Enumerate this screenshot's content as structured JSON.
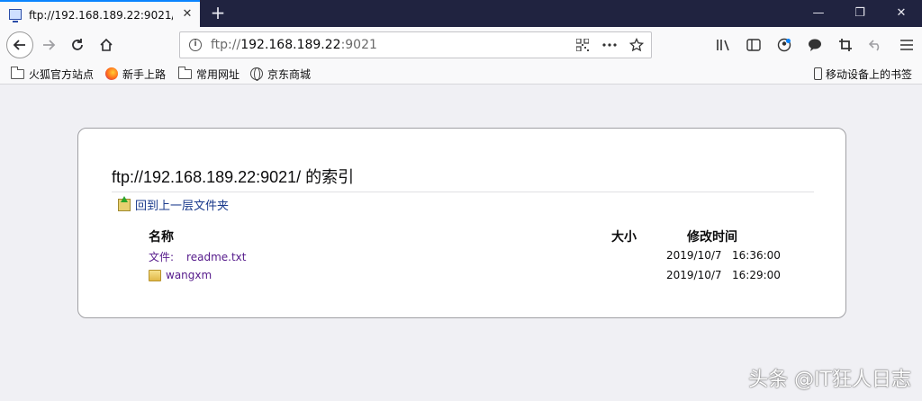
{
  "tab": {
    "title": "ftp://192.168.189.22:9021/ 的"
  },
  "window": {
    "minimize": "—",
    "restore": "❐",
    "close": "✕",
    "new_tab": "+"
  },
  "url": {
    "scheme": "ftp://",
    "host": "192.168.189.22",
    "port": ":9021"
  },
  "bookmarks": [
    {
      "label": "火狐官方站点",
      "icon": "folder-icon"
    },
    {
      "label": "新手上路",
      "icon": "firefox-icon"
    },
    {
      "label": "常用网址",
      "icon": "folder-icon"
    },
    {
      "label": "京东商城",
      "icon": "globe-icon"
    }
  ],
  "mobile_bookmarks": "移动设备上的书签",
  "page": {
    "heading": "ftp://192.168.189.22:9021/ 的索引",
    "up_link": "回到上一层文件夹",
    "columns": {
      "name": "名称",
      "size": "大小",
      "modified": "修改时间"
    },
    "rows": [
      {
        "prefix": "文件:",
        "name": "readme.txt",
        "date": "2019/10/7",
        "time": "16:36:00",
        "kind": "file"
      },
      {
        "prefix": "",
        "name": "wangxm",
        "date": "2019/10/7",
        "time": "16:29:00",
        "kind": "folder"
      }
    ]
  },
  "watermark": "头条 @IT狂人日志",
  "colors": {
    "tabstrip": "#202340",
    "accent": "#0a84ff",
    "visited_link": "#551a8b"
  }
}
